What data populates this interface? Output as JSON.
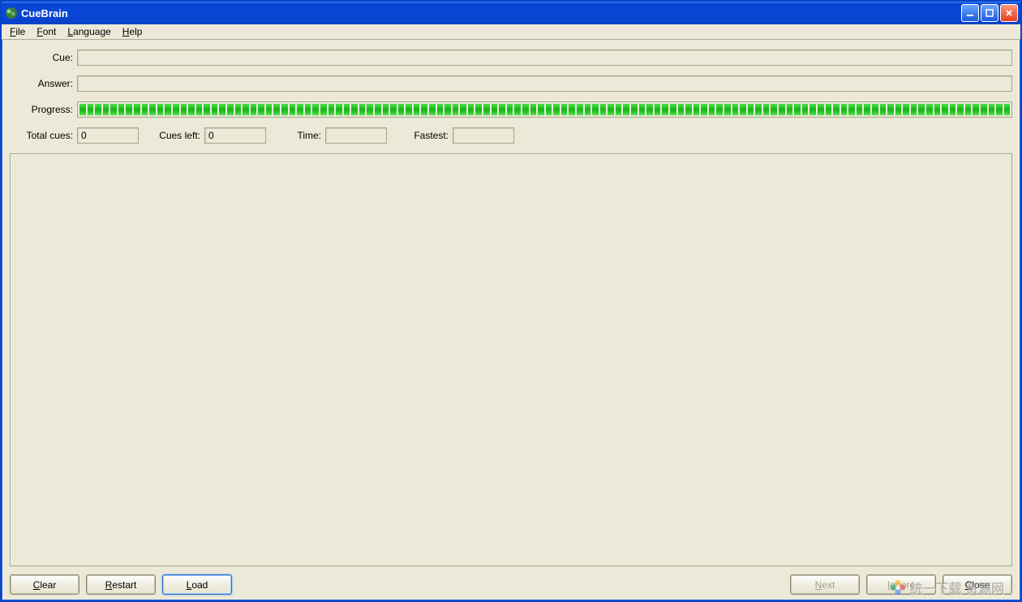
{
  "title": "CueBrain",
  "menu": {
    "file": "File",
    "font": "Font",
    "language": "Language",
    "help": "Help"
  },
  "labels": {
    "cue": "Cue:",
    "answer": "Answer:",
    "progress": "Progress:",
    "total_cues": "Total cues:",
    "cues_left": "Cues left:",
    "time": "Time:",
    "fastest": "Fastest:"
  },
  "values": {
    "cue": "",
    "answer": "",
    "total_cues": "0",
    "cues_left": "0",
    "time": "",
    "fastest": ""
  },
  "buttons": {
    "clear": "Clear",
    "restart": "Restart",
    "load": "Load",
    "next": "Next",
    "ignore": "Ignore",
    "close": "Close"
  },
  "watermark": "统一下载 资源网"
}
